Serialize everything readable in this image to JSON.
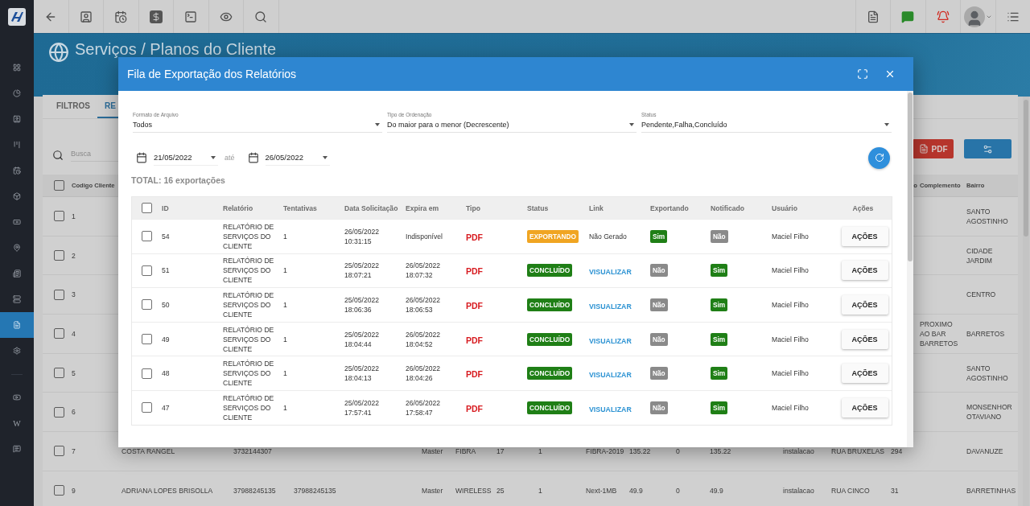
{
  "sidebar": {
    "items": [
      {
        "kind": "icon",
        "selected": false
      },
      {
        "kind": "icon",
        "selected": false
      },
      {
        "kind": "icon",
        "selected": false
      },
      {
        "kind": "icon",
        "selected": false
      },
      {
        "kind": "icon",
        "selected": false
      },
      {
        "kind": "icon",
        "selected": false
      },
      {
        "kind": "icon",
        "selected": false
      },
      {
        "kind": "icon",
        "selected": false
      },
      {
        "kind": "icon",
        "selected": false
      },
      {
        "kind": "icon",
        "selected": false
      },
      {
        "kind": "icon",
        "selected": true
      },
      {
        "kind": "icon",
        "selected": false
      },
      {
        "kind": "icon",
        "selected": false
      },
      {
        "kind": "glyph",
        "glyph": "W",
        "selected": false
      },
      {
        "kind": "icon",
        "selected": false
      }
    ]
  },
  "page": {
    "title": "Serviços / Planos do Cliente",
    "tabs": [
      {
        "label": "FILTROS",
        "selected": false
      },
      {
        "label": "RE",
        "selected": true
      }
    ],
    "search": {
      "placeholder": "Busca"
    },
    "pdf_button": "PDF",
    "table": {
      "select_all": {
        "checked": false
      },
      "columns": [
        "Codigo Cliente",
        "o",
        "Complemento",
        "Bairro"
      ],
      "rows": [
        {
          "checked": false,
          "id": "1",
          "neighborhood": "SANTO AGOSTINHO"
        },
        {
          "checked": false,
          "id": "2",
          "neighborhood": "CIDADE JARDIM"
        },
        {
          "checked": false,
          "id": "3",
          "neighborhood": "CENTRO"
        },
        {
          "checked": false,
          "id": "4",
          "complement": "PROXIMO AO BAR BARRETOS",
          "neighborhood": "BARRETOS"
        },
        {
          "checked": false,
          "id": "5",
          "neighborhood": "SANTO AGOSTINHO"
        },
        {
          "checked": false,
          "id": "6",
          "neighborhood": "MONSENHOR OTAVIANO"
        },
        {
          "checked": false,
          "id": "7",
          "name": "COSTA RANGEL",
          "phone_1": "3732144307",
          "plan_type": "Master",
          "technology": "FIBRA",
          "column_7": "17",
          "column_8": "1",
          "plan": "FIBRA-2019",
          "column_10": "135.22",
          "column_11": "0",
          "column_12": "135.22",
          "user": "instalacao",
          "street": "RUA BRUXELAS",
          "number": "294",
          "neighborhood": "DAVANUZE"
        },
        {
          "checked": false,
          "id": "9",
          "name": "ADRIANA LOPES BRISOLLA",
          "phone_1": "37988245135",
          "phone_2": "37988245135",
          "plan_type": "Master",
          "technology": "WIRELESS",
          "column_7": "25",
          "column_8": "1",
          "plan": "Next-1MB",
          "column_10": "49.9",
          "column_11": "0",
          "column_12": "49.9",
          "user": "instalacao",
          "street": "RUA CINCO",
          "number": "31",
          "neighborhood": "BARRETINHAS"
        }
      ]
    }
  },
  "dialog": {
    "title": "Fila de Exportação dos Relatórios",
    "filters": [
      {
        "label": "Formato de Arquivo",
        "value": "Todos"
      },
      {
        "label": "Tipo de Ordenação",
        "value": "Do maior para o menor (Decrescente)"
      },
      {
        "label": "Status",
        "value": "Pendente,Falha,Concluído"
      }
    ],
    "date_from": "21/05/2022",
    "date_separator": "até",
    "date_to": "26/05/2022",
    "total": "TOTAL: 16 exportações",
    "select_all": {
      "checked": false
    },
    "columns": [
      "ID",
      "Relatório",
      "Tentativas",
      "Data Solicitação",
      "Expira em",
      "Tipo",
      "Status",
      "Link",
      "Exportando",
      "Notificado",
      "Usuário",
      "Ações"
    ],
    "rows": [
      {
        "checked": false,
        "id": "54",
        "report": "RELATÓRIO DE SERVIÇOS DO CLIENTE",
        "attempts": "1",
        "requested": "26/05/2022 10:31:15",
        "expires": "Indisponível",
        "type": "PDF",
        "status": {
          "text": "EXPORTANDO",
          "kind": "exporting"
        },
        "link": {
          "text": "Não Gerado",
          "kind": "plain"
        },
        "exporting": {
          "text": "Sim",
          "on": true
        },
        "notified": {
          "text": "Não",
          "on": false
        },
        "user": "Maciel Filho",
        "action": "AÇÕES"
      },
      {
        "checked": false,
        "id": "51",
        "report": "RELATÓRIO DE SERVIÇOS DO CLIENTE",
        "attempts": "1",
        "requested": "25/05/2022 18:07:21",
        "expires": "26/05/2022 18:07:32",
        "type": "PDF",
        "status": {
          "text": "CONCLUÍDO",
          "kind": "done"
        },
        "link": {
          "text": "VISUALIZAR",
          "kind": "link"
        },
        "exporting": {
          "text": "Não",
          "on": false
        },
        "notified": {
          "text": "Sim",
          "on": true
        },
        "user": "Maciel Filho",
        "action": "AÇÕES"
      },
      {
        "checked": false,
        "id": "50",
        "report": "RELATÓRIO DE SERVIÇOS DO CLIENTE",
        "attempts": "1",
        "requested": "25/05/2022 18:06:36",
        "expires": "26/05/2022 18:06:53",
        "type": "PDF",
        "status": {
          "text": "CONCLUÍDO",
          "kind": "done"
        },
        "link": {
          "text": "VISUALIZAR",
          "kind": "link"
        },
        "exporting": {
          "text": "Não",
          "on": false
        },
        "notified": {
          "text": "Sim",
          "on": true
        },
        "user": "Maciel Filho",
        "action": "AÇÕES"
      },
      {
        "checked": false,
        "id": "49",
        "report": "RELATÓRIO DE SERVIÇOS DO CLIENTE",
        "attempts": "1",
        "requested": "25/05/2022 18:04:44",
        "expires": "26/05/2022 18:04:52",
        "type": "PDF",
        "status": {
          "text": "CONCLUÍDO",
          "kind": "done"
        },
        "link": {
          "text": "VISUALIZAR",
          "kind": "link"
        },
        "exporting": {
          "text": "Não",
          "on": false
        },
        "notified": {
          "text": "Sim",
          "on": true
        },
        "user": "Maciel Filho",
        "action": "AÇÕES"
      },
      {
        "checked": false,
        "id": "48",
        "report": "RELATÓRIO DE SERVIÇOS DO CLIENTE",
        "attempts": "1",
        "requested": "25/05/2022 18:04:13",
        "expires": "26/05/2022 18:04:26",
        "type": "PDF",
        "status": {
          "text": "CONCLUÍDO",
          "kind": "done"
        },
        "link": {
          "text": "VISUALIZAR",
          "kind": "link"
        },
        "exporting": {
          "text": "Não",
          "on": false
        },
        "notified": {
          "text": "Sim",
          "on": true
        },
        "user": "Maciel Filho",
        "action": "AÇÕES"
      },
      {
        "checked": false,
        "id": "47",
        "report": "RELATÓRIO DE SERVIÇOS DO CLIENTE",
        "attempts": "1",
        "requested": "25/05/2022 17:57:41",
        "expires": "26/05/2022 17:58:47",
        "type": "PDF",
        "status": {
          "text": "CONCLUÍDO",
          "kind": "done"
        },
        "link": {
          "text": "VISUALIZAR",
          "kind": "link"
        },
        "exporting": {
          "text": "Não",
          "on": false
        },
        "notified": {
          "text": "Sim",
          "on": true
        },
        "user": "Maciel Filho",
        "action": "AÇÕES"
      }
    ]
  }
}
